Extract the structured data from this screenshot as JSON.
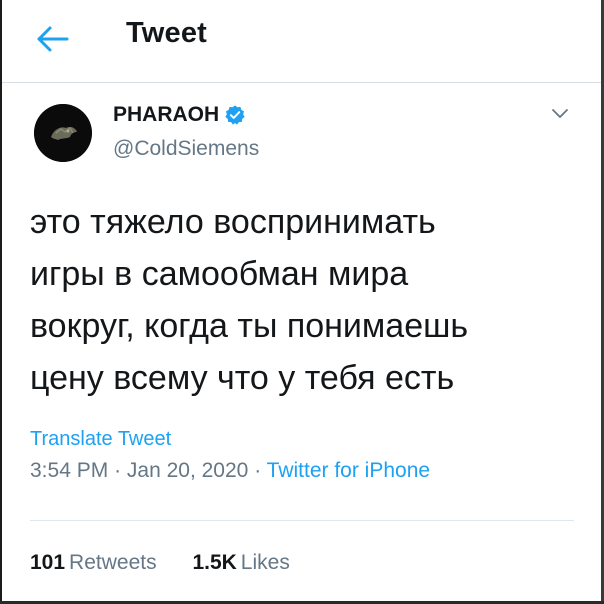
{
  "header": {
    "title": "Tweet",
    "back_icon": "arrow-left-icon"
  },
  "author": {
    "display_name": "PHARAOH",
    "handle": "@ColdSiemens",
    "verified": true,
    "verified_icon": "verified-badge-icon",
    "avatar_icon": "dark-avatar"
  },
  "menu_icon": "chevron-down-icon",
  "tweet": {
    "lines": [
      "это тяжело воспринимать",
      "игры в самообман мира",
      "вокруг, когда ты понимаешь",
      "цену всему что у тебя есть"
    ],
    "translate_label": "Translate Tweet",
    "time": "3:54 PM",
    "separator": "·",
    "date": "Jan 20, 2020",
    "source": "Twitter for iPhone"
  },
  "stats": {
    "retweets_count": "101",
    "retweets_label": "Retweets",
    "likes_count": "1.5K",
    "likes_label": "Likes"
  },
  "colors": {
    "accent": "#1da1f2",
    "secondary_text": "#657786",
    "primary_text": "#14171a"
  }
}
